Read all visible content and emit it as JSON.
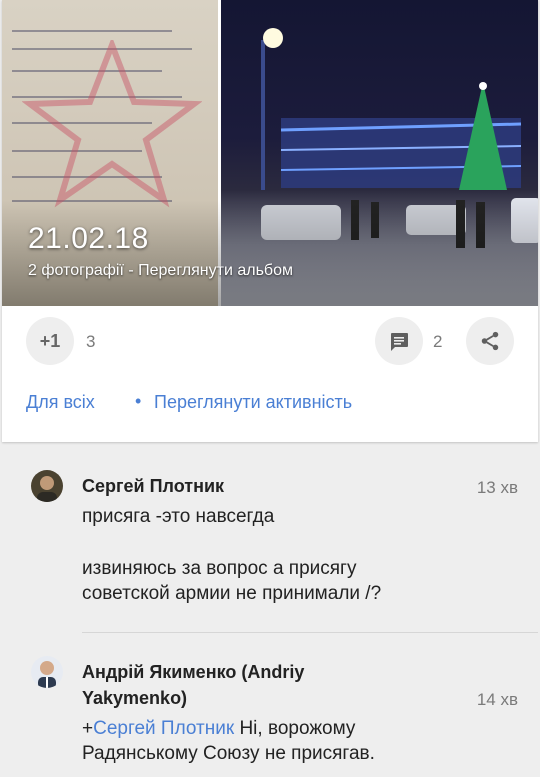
{
  "post": {
    "photo_date": "21.02.18",
    "photo_caption": "2 фотографії - Переглянути альбом",
    "plus_one_label": "+1",
    "plus_one_count": "3",
    "comment_count": "2",
    "visibility_label": "Для всіх",
    "separator": "•",
    "view_activity_label": "Переглянути активність"
  },
  "comments": [
    {
      "author": "Сергей Плотник",
      "time": "13 хв",
      "line1": "присяга -это навсегда",
      "line2": "извиняюсь за вопрос  а присягу",
      "line3": "советской армии не принимали /?"
    },
    {
      "author_line1": "Андрій Якименко (Andriy",
      "author_line2": "Yakymenko)",
      "time": "14 хв",
      "mention_prefix": "+",
      "mention": "Сергей Плотник",
      "text_after_mention": " Ні, ворожому",
      "line2": "Радянському Союзу не присягав."
    }
  ],
  "icons": {
    "comment": "comment-icon",
    "share": "share-icon"
  },
  "colors": {
    "link": "#4a7fd4",
    "background": "#eeeeee",
    "card": "#ffffff"
  }
}
